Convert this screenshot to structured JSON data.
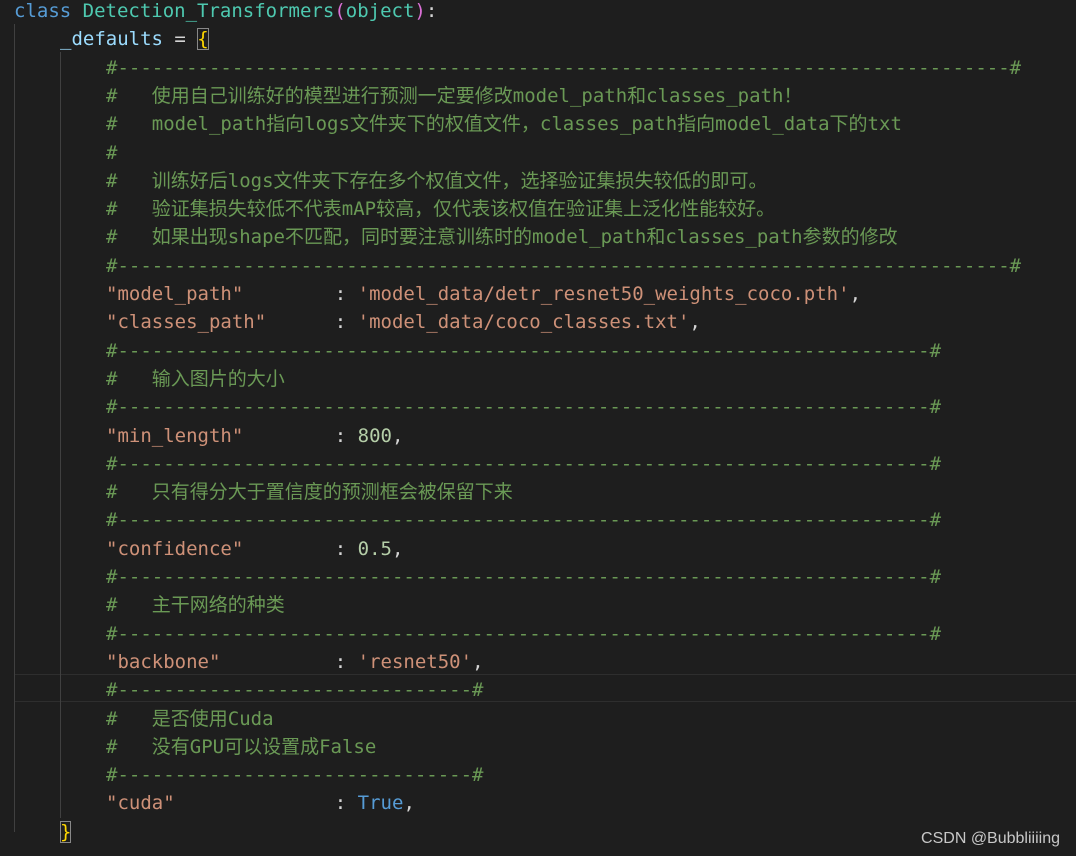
{
  "code": {
    "lines": [
      {
        "row": 0,
        "indent": 0,
        "tokens": [
          {
            "t": "class",
            "c": "kw"
          },
          {
            "t": " ",
            "c": "punc"
          },
          {
            "t": "Detection_Transformers",
            "c": "cls"
          },
          {
            "t": "(",
            "c": "paren"
          },
          {
            "t": "object",
            "c": "cls"
          },
          {
            "t": ")",
            "c": "paren"
          },
          {
            "t": ":",
            "c": "punc"
          }
        ]
      },
      {
        "row": 1,
        "indent": 1,
        "tokens": [
          {
            "t": "_defaults",
            "c": "var"
          },
          {
            "t": " = ",
            "c": "punc"
          },
          {
            "t": "{",
            "c": "brace",
            "box": true
          }
        ]
      },
      {
        "row": 2,
        "indent": 2,
        "tokens": [
          {
            "t": "#------------------------------------------------------------------------------#",
            "c": "cm"
          }
        ]
      },
      {
        "row": 3,
        "indent": 2,
        "tokens": [
          {
            "t": "#   使用自己训练好的模型进行预测一定要修改model_path和classes_path！",
            "c": "cm"
          }
        ]
      },
      {
        "row": 4,
        "indent": 2,
        "tokens": [
          {
            "t": "#   model_path指向logs文件夹下的权值文件，classes_path指向model_data下的txt",
            "c": "cm"
          }
        ]
      },
      {
        "row": 5,
        "indent": 2,
        "tokens": [
          {
            "t": "#",
            "c": "cm"
          }
        ]
      },
      {
        "row": 6,
        "indent": 2,
        "tokens": [
          {
            "t": "#   训练好后logs文件夹下存在多个权值文件，选择验证集损失较低的即可。",
            "c": "cm"
          }
        ]
      },
      {
        "row": 7,
        "indent": 2,
        "tokens": [
          {
            "t": "#   验证集损失较低不代表mAP较高，仅代表该权值在验证集上泛化性能较好。",
            "c": "cm"
          }
        ]
      },
      {
        "row": 8,
        "indent": 2,
        "tokens": [
          {
            "t": "#   如果出现shape不匹配，同时要注意训练时的model_path和classes_path参数的修改",
            "c": "cm"
          }
        ]
      },
      {
        "row": 9,
        "indent": 2,
        "tokens": [
          {
            "t": "#------------------------------------------------------------------------------#",
            "c": "cm"
          }
        ]
      },
      {
        "row": 10,
        "indent": 2,
        "tokens": [
          {
            "t": "\"model_path\"",
            "c": "str"
          },
          {
            "t": "        : ",
            "c": "punc"
          },
          {
            "t": "'model_data/detr_resnet50_weights_coco.pth'",
            "c": "str"
          },
          {
            "t": ",",
            "c": "punc"
          }
        ]
      },
      {
        "row": 11,
        "indent": 2,
        "tokens": [
          {
            "t": "\"classes_path\"",
            "c": "str"
          },
          {
            "t": "      : ",
            "c": "punc"
          },
          {
            "t": "'model_data/coco_classes.txt'",
            "c": "str"
          },
          {
            "t": ",",
            "c": "punc"
          }
        ]
      },
      {
        "row": 12,
        "indent": 2,
        "tokens": [
          {
            "t": "#-----------------------------------------------------------------------#",
            "c": "cm"
          }
        ]
      },
      {
        "row": 13,
        "indent": 2,
        "tokens": [
          {
            "t": "#   输入图片的大小",
            "c": "cm"
          }
        ]
      },
      {
        "row": 14,
        "indent": 2,
        "tokens": [
          {
            "t": "#-----------------------------------------------------------------------#",
            "c": "cm"
          }
        ]
      },
      {
        "row": 15,
        "indent": 2,
        "tokens": [
          {
            "t": "\"min_length\"",
            "c": "str"
          },
          {
            "t": "        : ",
            "c": "punc"
          },
          {
            "t": "800",
            "c": "num"
          },
          {
            "t": ",",
            "c": "punc"
          }
        ]
      },
      {
        "row": 16,
        "indent": 2,
        "tokens": [
          {
            "t": "#-----------------------------------------------------------------------#",
            "c": "cm"
          }
        ]
      },
      {
        "row": 17,
        "indent": 2,
        "tokens": [
          {
            "t": "#   只有得分大于置信度的预测框会被保留下来",
            "c": "cm"
          }
        ]
      },
      {
        "row": 18,
        "indent": 2,
        "tokens": [
          {
            "t": "#-----------------------------------------------------------------------#",
            "c": "cm"
          }
        ]
      },
      {
        "row": 19,
        "indent": 2,
        "tokens": [
          {
            "t": "\"confidence\"",
            "c": "str"
          },
          {
            "t": "        : ",
            "c": "punc"
          },
          {
            "t": "0.5",
            "c": "num"
          },
          {
            "t": ",",
            "c": "punc"
          }
        ]
      },
      {
        "row": 20,
        "indent": 2,
        "tokens": [
          {
            "t": "#-----------------------------------------------------------------------#",
            "c": "cm"
          }
        ]
      },
      {
        "row": 21,
        "indent": 2,
        "tokens": [
          {
            "t": "#   主干网络的种类",
            "c": "cm"
          }
        ]
      },
      {
        "row": 22,
        "indent": 2,
        "tokens": [
          {
            "t": "#-----------------------------------------------------------------------#",
            "c": "cm"
          }
        ]
      },
      {
        "row": 23,
        "indent": 2,
        "tokens": [
          {
            "t": "\"backbone\"",
            "c": "str"
          },
          {
            "t": "          : ",
            "c": "punc"
          },
          {
            "t": "'resnet50'",
            "c": "str"
          },
          {
            "t": ",",
            "c": "punc"
          }
        ]
      },
      {
        "row": 24,
        "indent": 2,
        "tokens": [
          {
            "t": "#-------------------------------#",
            "c": "cm"
          }
        ]
      },
      {
        "row": 25,
        "indent": 2,
        "tokens": [
          {
            "t": "#   是否使用Cuda",
            "c": "cm"
          }
        ]
      },
      {
        "row": 26,
        "indent": 2,
        "tokens": [
          {
            "t": "#   没有GPU可以设置成False",
            "c": "cm"
          }
        ]
      },
      {
        "row": 27,
        "indent": 2,
        "tokens": [
          {
            "t": "#-------------------------------#",
            "c": "cm"
          }
        ]
      },
      {
        "row": 28,
        "indent": 2,
        "tokens": [
          {
            "t": "\"cuda\"",
            "c": "str"
          },
          {
            "t": "              : ",
            "c": "punc"
          },
          {
            "t": "True",
            "c": "bool"
          },
          {
            "t": ",",
            "c": "punc"
          }
        ]
      },
      {
        "row": 29,
        "indent": 1,
        "tokens": [
          {
            "t": "}",
            "c": "brace",
            "box": true
          }
        ]
      }
    ]
  },
  "watermark": "CSDN @Bubbliiiing",
  "colors": {
    "background": "#1e1e1e",
    "keyword": "#569cd6",
    "class_name": "#4ec9b0",
    "string": "#ce9178",
    "number": "#b5cea8",
    "comment": "#6a9955",
    "brace": "#ffd700"
  }
}
